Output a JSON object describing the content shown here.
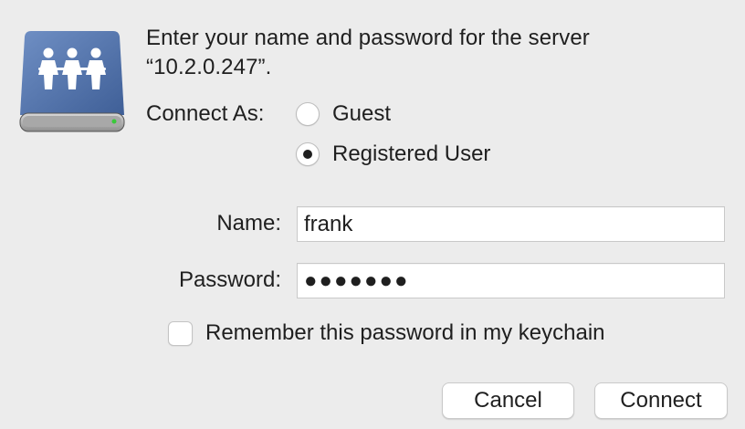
{
  "dialog": {
    "message_line1": "Enter your name and password for the server",
    "message_line2": "“10.2.0.247”.",
    "icon": "server-network-icon"
  },
  "connect_as": {
    "label": "Connect As:",
    "options": [
      {
        "label": "Guest",
        "selected": false
      },
      {
        "label": "Registered User",
        "selected": true
      }
    ]
  },
  "fields": {
    "name_label": "Name:",
    "name_value": "frank",
    "password_label": "Password:",
    "password_value": "●●●●●●●"
  },
  "remember": {
    "label": "Remember this password in my keychain",
    "checked": false
  },
  "buttons": {
    "cancel_label": "Cancel",
    "connect_label": "Connect"
  },
  "colors": {
    "window_background": "#ececec",
    "icon_blue": "#4a6aa0",
    "indicator_green": "#39c93a"
  }
}
